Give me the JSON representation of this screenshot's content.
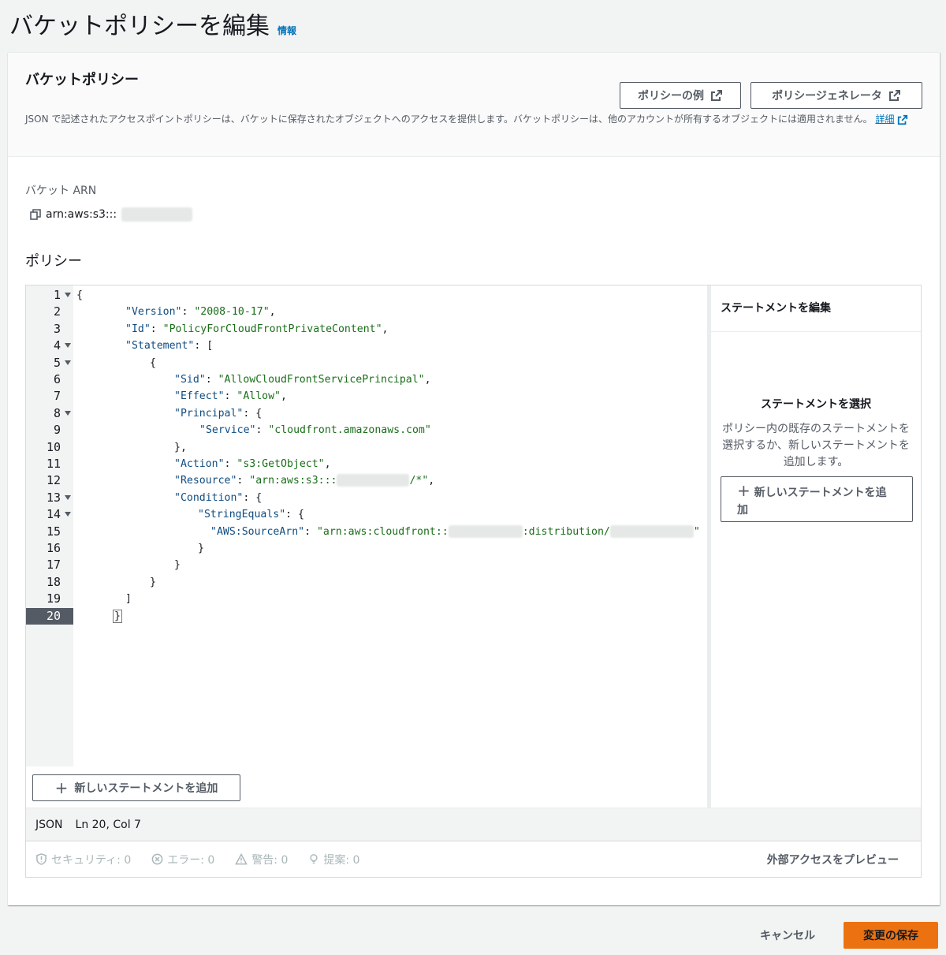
{
  "page": {
    "title": "バケットポリシーを編集",
    "info_link": "情報"
  },
  "panel": {
    "title": "バケットポリシー",
    "example_button": "ポリシーの例",
    "generator_button": "ポリシージェネレータ",
    "description": "JSON で記述されたアクセスポイントポリシーは、バケットに保存されたオブジェクトへのアクセスを提供します。バケットポリシーは、他のアカウントが所有するオブジェクトには適用されません。",
    "details_link": "詳細"
  },
  "arn": {
    "label": "バケット ARN",
    "value_prefix": "arn:aws:s3:::"
  },
  "policy": {
    "label": "ポリシー"
  },
  "editor": {
    "lines": [
      {
        "n": "1",
        "fold": true
      },
      {
        "n": "2",
        "fold": false
      },
      {
        "n": "3",
        "fold": false
      },
      {
        "n": "4",
        "fold": true
      },
      {
        "n": "5",
        "fold": true
      },
      {
        "n": "6",
        "fold": false
      },
      {
        "n": "7",
        "fold": false
      },
      {
        "n": "8",
        "fold": true
      },
      {
        "n": "9",
        "fold": false
      },
      {
        "n": "10",
        "fold": false
      },
      {
        "n": "11",
        "fold": false
      },
      {
        "n": "12",
        "fold": false
      },
      {
        "n": "13",
        "fold": true
      },
      {
        "n": "14",
        "fold": true
      },
      {
        "n": "15",
        "fold": false
      },
      {
        "n": "16",
        "fold": false
      },
      {
        "n": "17",
        "fold": false
      },
      {
        "n": "18",
        "fold": false
      },
      {
        "n": "19",
        "fold": false
      },
      {
        "n": "20",
        "fold": false
      }
    ],
    "active_line": "20",
    "code": {
      "l1": "{",
      "version_key": "\"Version\"",
      "version_val": "\"2008-10-17\"",
      "id_key": "\"Id\"",
      "id_val": "\"PolicyForCloudFrontPrivateContent\"",
      "statement_key": "\"Statement\"",
      "sid_key": "\"Sid\"",
      "sid_val": "\"AllowCloudFrontServicePrincipal\"",
      "effect_key": "\"Effect\"",
      "effect_val": "\"Allow\"",
      "principal_key": "\"Principal\"",
      "service_key": "\"Service\"",
      "service_val": "\"cloudfront.amazonaws.com\"",
      "action_key": "\"Action\"",
      "action_val": "\"s3:GetObject\"",
      "resource_key": "\"Resource\"",
      "resource_prefix": "\"arn:aws:s3:::",
      "resource_suffix": "/*\"",
      "condition_key": "\"Condition\"",
      "stringequals_key": "\"StringEquals\"",
      "sourcearn_key": "\"AWS:SourceArn\"",
      "sourcearn_prefix": "\"arn:aws:cloudfront::",
      "sourcearn_mid": ":distribution/",
      "sourcearn_suffix": "\""
    },
    "add_statement_button": "新しいステートメントを追加",
    "status_lang": "JSON",
    "status_pos": "Ln 20, Col 7"
  },
  "side": {
    "title": "ステートメントを編集",
    "heading": "ステートメントを選択",
    "text": "ポリシー内の既存のステートメントを選択するか、新しいステートメントを追加します。",
    "button": "新しいステートメントを追加"
  },
  "validation": {
    "security": "セキュリティ: 0",
    "errors": "エラー: 0",
    "warnings": "警告: 0",
    "suggestions": "提案: 0",
    "preview": "外部アクセスをプレビュー"
  },
  "footer": {
    "cancel": "キャンセル",
    "save": "変更の保存"
  },
  "colors": {
    "primary": "#ec7211",
    "link": "#0073bb",
    "active_line": "#545b64"
  }
}
